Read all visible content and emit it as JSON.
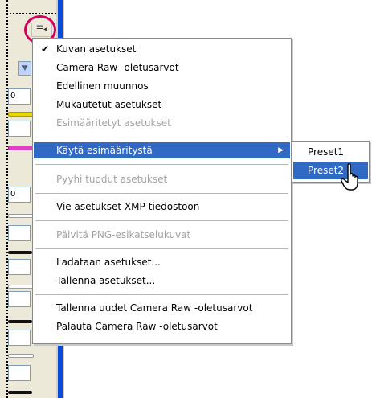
{
  "panel": {
    "fields": [
      {
        "value": "0"
      },
      {
        "value": ""
      },
      {
        "value": "0"
      },
      {
        "value": ""
      },
      {
        "value": ""
      },
      {
        "value": ""
      },
      {
        "value": ""
      },
      {
        "value": ""
      }
    ],
    "colors": {
      "yellow": "#e8d800",
      "magenta": "#e040c8",
      "blue_bar": "#0a4ad8"
    }
  },
  "menu_button": {
    "icon": "menu-list-icon",
    "glyph": "☰◂"
  },
  "menu": {
    "items": [
      {
        "label": "Kuvan asetukset",
        "checked": true,
        "disabled": false
      },
      {
        "label": "Camera Raw -oletusarvot",
        "disabled": false
      },
      {
        "label": "Edellinen muunnos",
        "disabled": false
      },
      {
        "label": "Mukautetut asetukset",
        "disabled": false
      },
      {
        "label": "Esimääritetyt asetukset",
        "disabled": true
      },
      {
        "label": "Käytä esimääritystä",
        "disabled": false,
        "submenu": true,
        "highlighted": true
      },
      {
        "label": "Pyyhi tuodut asetukset",
        "disabled": true
      },
      {
        "label": "Vie asetukset XMP-tiedostoon",
        "disabled": false
      },
      {
        "label": "Päivitä PNG-esikatselukuvat",
        "disabled": true
      },
      {
        "label": "Ladataan asetukset...",
        "disabled": false
      },
      {
        "label": "Tallenna asetukset...",
        "disabled": false
      },
      {
        "label": "Tallenna uudet Camera Raw -oletusarvot",
        "disabled": false
      },
      {
        "label": "Palauta Camera Raw -oletusarvot",
        "disabled": false
      }
    ],
    "check_glyph": "✔",
    "arrow_glyph": "▶"
  },
  "submenu": {
    "items": [
      {
        "label": "Preset1",
        "highlighted": false
      },
      {
        "label": "Preset2",
        "highlighted": true
      }
    ]
  }
}
